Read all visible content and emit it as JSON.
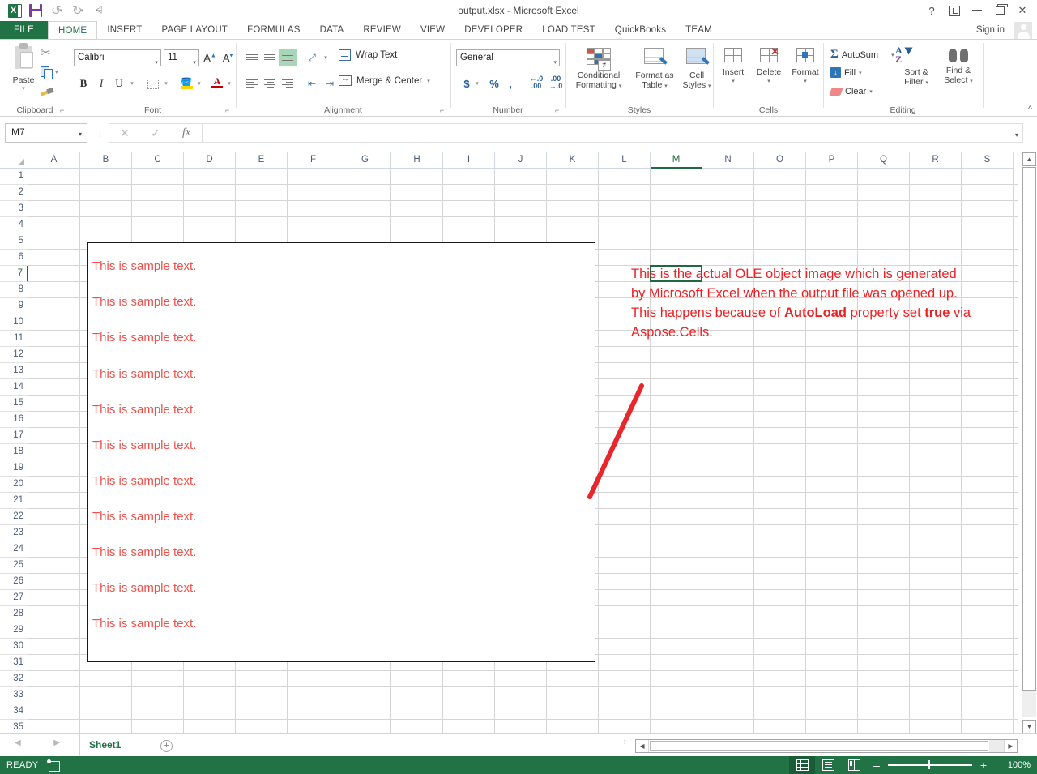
{
  "titlebar": {
    "title": "output.xlsx - Microsoft Excel",
    "qat": [
      {
        "name": "excel-logo",
        "label": ""
      },
      {
        "name": "save-icon",
        "label": ""
      },
      {
        "name": "undo-icon",
        "label": "↰"
      },
      {
        "name": "redo-icon",
        "label": "↱"
      },
      {
        "name": "customize-qat-icon",
        "label": "⩒"
      }
    ],
    "help_label": "?",
    "ribbon_display_label": "",
    "minimize_label": "",
    "restore_label": "",
    "close_label": "✕"
  },
  "tabs": {
    "items": [
      {
        "label": "FILE",
        "key": "file"
      },
      {
        "label": "HOME",
        "key": "home"
      },
      {
        "label": "INSERT",
        "key": "insert"
      },
      {
        "label": "PAGE LAYOUT",
        "key": "page-layout"
      },
      {
        "label": "FORMULAS",
        "key": "formulas"
      },
      {
        "label": "DATA",
        "key": "data"
      },
      {
        "label": "REVIEW",
        "key": "review"
      },
      {
        "label": "VIEW",
        "key": "view"
      },
      {
        "label": "DEVELOPER",
        "key": "developer"
      },
      {
        "label": "LOAD TEST",
        "key": "load-test"
      },
      {
        "label": "QuickBooks",
        "key": "quickbooks"
      },
      {
        "label": "TEAM",
        "key": "team"
      }
    ],
    "active": "HOME",
    "signin": "Sign in"
  },
  "ribbon": {
    "groups": {
      "clipboard": {
        "label": "Clipboard",
        "paste": "Paste",
        "cut": "Cut",
        "copy": "Copy",
        "format_painter": "Format Painter"
      },
      "font": {
        "label": "Font",
        "font_name": "Calibri",
        "font_size": "11",
        "grow_font": "A",
        "shrink_font": "A",
        "bold": "B",
        "italic": "I",
        "underline": "U",
        "borders": "",
        "fill_color": "",
        "font_color": "A"
      },
      "alignment": {
        "label": "Alignment",
        "wrap_text": "Wrap Text",
        "merge_center": "Merge & Center"
      },
      "number": {
        "label": "Number",
        "format": "General",
        "currency": "$",
        "percent": "%",
        "comma": ",",
        "increase_decimal": ".00",
        "decrease_decimal": ".00"
      },
      "styles": {
        "label": "Styles",
        "conditional_formatting": "Conditional\nFormatting",
        "conditional_formatting_l1": "Conditional",
        "conditional_formatting_l2": "Formatting",
        "format_as_table_l1": "Format as",
        "format_as_table_l2": "Table",
        "cell_styles_l1": "Cell",
        "cell_styles_l2": "Styles"
      },
      "cells": {
        "label": "Cells",
        "insert": "Insert",
        "delete": "Delete",
        "format": "Format"
      },
      "editing": {
        "label": "Editing",
        "autosum": "AutoSum",
        "fill": "Fill",
        "clear": "Clear",
        "sort_filter_l1": "Sort &",
        "sort_filter_l2": "Filter",
        "find_select_l1": "Find &",
        "find_select_l2": "Select"
      }
    },
    "collapse_label": "^"
  },
  "formula_bar": {
    "name_box": "M7",
    "cancel": "✕",
    "enter": "✓",
    "fx": "fx",
    "content": ""
  },
  "grid": {
    "columns": [
      "A",
      "B",
      "C",
      "D",
      "E",
      "F",
      "G",
      "H",
      "I",
      "J",
      "K",
      "L",
      "M",
      "N",
      "O",
      "P",
      "Q",
      "R",
      "S"
    ],
    "selected_column": "M",
    "rows": [
      1,
      2,
      3,
      4,
      5,
      6,
      7,
      8,
      9,
      10,
      11,
      12,
      13,
      14,
      15,
      16,
      17,
      18,
      19,
      20,
      21,
      22,
      23,
      24,
      25,
      26,
      27,
      28,
      29,
      30,
      31,
      32,
      33,
      34,
      35
    ],
    "selected_row": 7,
    "active_cell": "M7",
    "ole_object": {
      "name": "ole-object-image",
      "text_color": "#f1504a",
      "lines": [
        "This is sample text.",
        "This is sample text.",
        "This is sample text.",
        "This is sample text.",
        "This is sample text.",
        "This is sample text.",
        "This is sample text.",
        "This is sample text.",
        "This is sample text.",
        "This is sample text.",
        "This is sample text."
      ]
    },
    "annotation": {
      "color": "#ed2024",
      "segments": [
        {
          "text": "This is the actual OLE object image which is generated by Microsoft Excel when the output file was opened up. This happens because of ",
          "bold": false
        },
        {
          "text": "AutoLoad",
          "bold": true
        },
        {
          "text": " property set ",
          "bold": false
        },
        {
          "text": "true",
          "bold": true
        },
        {
          "text": " via Aspose.Cells.",
          "bold": false
        }
      ],
      "full_text": "This is the actual OLE object image which is generated by Microsoft Excel when the output file was opened up. This happens because of AutoLoad property set true via Aspose.Cells.",
      "arrow_color": "#e8262c"
    }
  },
  "sheet_tabs": {
    "first_label": "◀",
    "prev_label": "◀",
    "next_label": "▶",
    "sheets": [
      {
        "label": "Sheet1",
        "active": true
      }
    ],
    "add_sheet_label": "+"
  },
  "scrollbars": {
    "h_left": "◀",
    "h_right": "▶",
    "v_up": "▲",
    "v_down": "▼"
  },
  "status_bar": {
    "state": "READY",
    "macro_record": "",
    "views": [
      {
        "name": "normal-view",
        "active": true
      },
      {
        "name": "page-layout-view",
        "active": false
      },
      {
        "name": "page-break-preview",
        "active": false
      }
    ],
    "zoom_out": "–",
    "zoom_in": "+",
    "zoom_level": "100%"
  },
  "colors": {
    "excel_green": "#217346",
    "status_green": "#217346",
    "annotation_red": "#ed2024",
    "sample_red": "#f1504a"
  }
}
